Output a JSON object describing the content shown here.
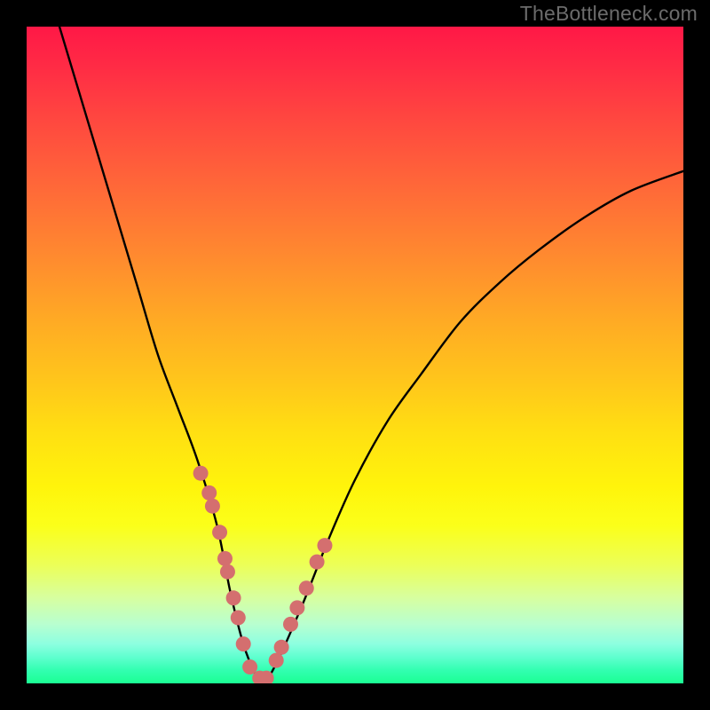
{
  "watermark": "TheBottleneck.com",
  "chart_data": {
    "type": "line",
    "title": "",
    "xlabel": "",
    "ylabel": "",
    "xlim": [
      0,
      100
    ],
    "ylim": [
      0,
      100
    ],
    "series": [
      {
        "name": "bottleneck-curve",
        "x": [
          5,
          8,
          11,
          14,
          17,
          20,
          23,
          26,
          29,
          31,
          33,
          35,
          36,
          38,
          42,
          46,
          50,
          55,
          60,
          66,
          72,
          78,
          85,
          92,
          100
        ],
        "y": [
          100,
          90,
          80,
          70,
          60,
          50,
          42,
          34,
          24,
          14,
          6,
          1,
          0,
          3,
          12,
          22,
          31,
          40,
          47,
          55,
          61,
          66,
          71,
          75,
          78
        ]
      }
    ],
    "markers": {
      "name": "highlight-dots",
      "color": "#d46f6f",
      "points_x": [
        26.5,
        27.8,
        28.3,
        29.4,
        30.2,
        30.6,
        31.5,
        32.2,
        33.0,
        34.0,
        35.5,
        36.5,
        38.0,
        38.8,
        40.2,
        41.2,
        42.6,
        44.2,
        45.4
      ],
      "points_y": [
        32,
        29,
        27,
        23,
        19,
        17,
        13,
        10,
        6,
        2.5,
        0.8,
        0.8,
        3.5,
        5.5,
        9,
        11.5,
        14.5,
        18.5,
        21
      ]
    },
    "gradient_stops": [
      {
        "pos": 0,
        "color": "#ff1846"
      },
      {
        "pos": 50,
        "color": "#ffc91a"
      },
      {
        "pos": 80,
        "color": "#f4ff3a"
      },
      {
        "pos": 100,
        "color": "#1bff93"
      }
    ]
  }
}
